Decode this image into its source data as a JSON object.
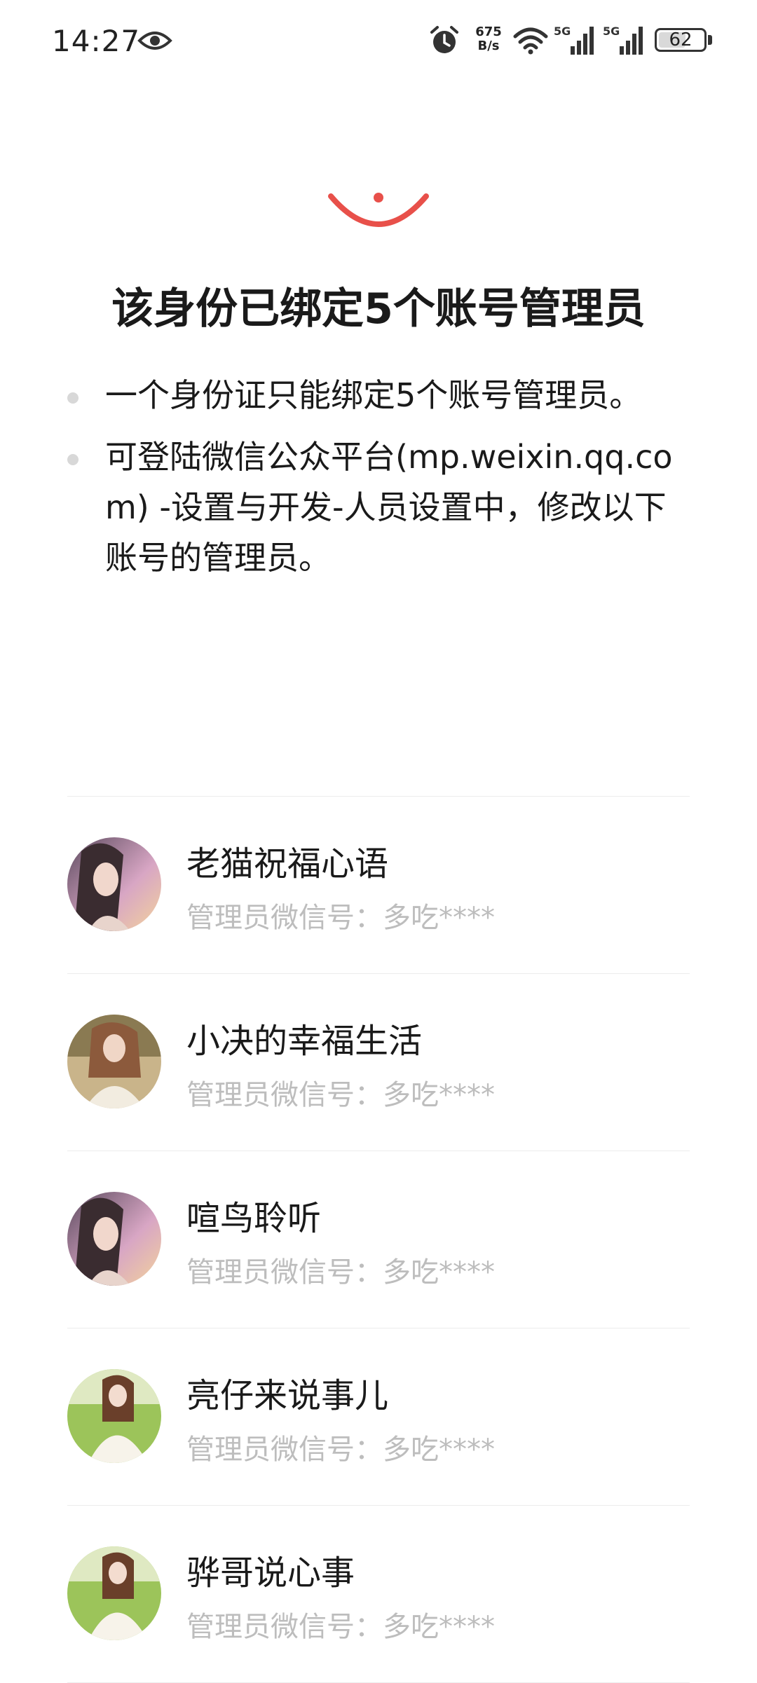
{
  "status_bar": {
    "time": "14:27",
    "net_speed_value": "675",
    "net_speed_unit": "B/s",
    "battery": "62",
    "battery_level": 0.62
  },
  "title": "该身份已绑定5个账号管理员",
  "notes": [
    "一个身份证只能绑定5个账号管理员。",
    "可登陆微信公众平台(mp.weixin.qq.com) -设置与开发-人员设置中，修改以下账号的管理员。"
  ],
  "admin_label": "管理员微信号：",
  "accounts": [
    {
      "name": "老猫祝福心语",
      "admin_id": "多吃****"
    },
    {
      "name": "小决的幸福生活",
      "admin_id": "多吃****"
    },
    {
      "name": "喧鸟聆听",
      "admin_id": "多吃****"
    },
    {
      "name": "亮仔来说事儿",
      "admin_id": "多吃****"
    },
    {
      "name": "骅哥说心事",
      "admin_id": "多吃****"
    }
  ],
  "colors": {
    "accent": "#e8504a",
    "secondary_text": "#bdbdbd"
  }
}
